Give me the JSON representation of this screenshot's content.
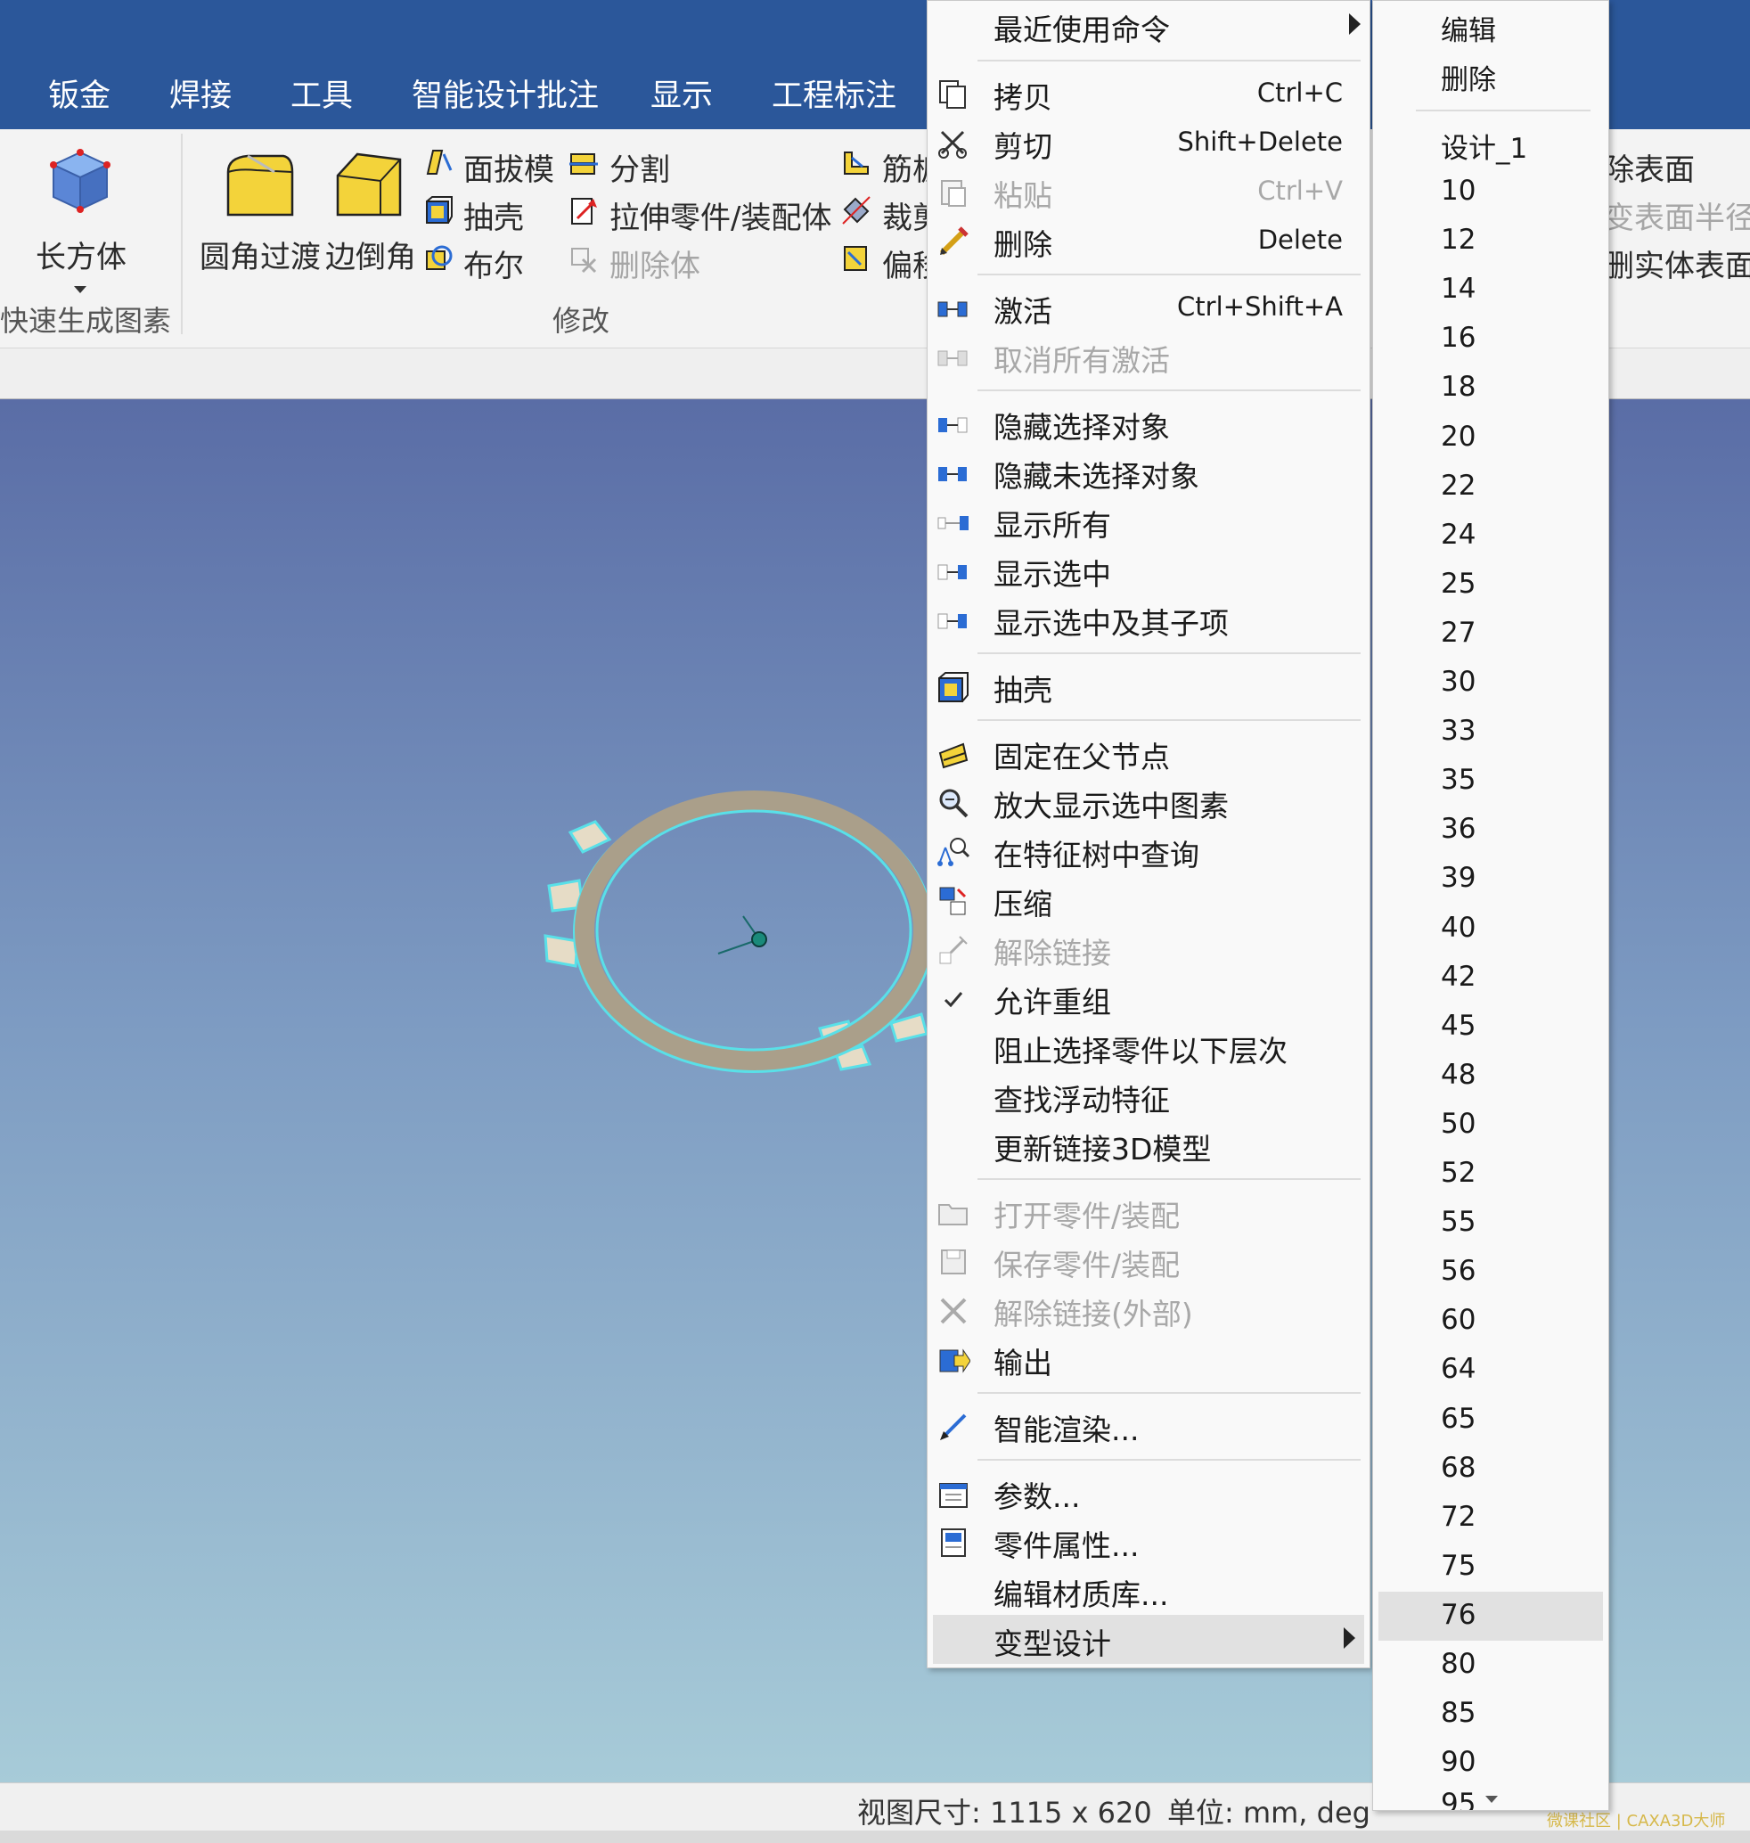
{
  "tabs": [
    "钣金",
    "焊接",
    "工具",
    "智能设计批注",
    "显示",
    "工程标注"
  ],
  "ribbon": {
    "box_label": "长方体",
    "group_quick": "快速生成图素",
    "fillet": "圆角过渡",
    "chamfer": "边倒角",
    "face_draft": "面拔模",
    "shell": "抽壳",
    "boolean": "布尔",
    "split": "分割",
    "stretch": "拉伸零件/装配体",
    "delete_body": "删除体",
    "rib": "筋板",
    "trim": "裁剪",
    "offset": "偏移",
    "group_modify": "修改",
    "right_1": "除表面",
    "right_2": "变表面半径",
    "right_3": "删实体表面"
  },
  "context_menu": {
    "recent": "最近使用命令",
    "copy": {
      "label": "拷贝",
      "shortcut": "Ctrl+C"
    },
    "cut": {
      "label": "剪切",
      "shortcut": "Shift+Delete"
    },
    "paste": {
      "label": "粘贴",
      "shortcut": "Ctrl+V"
    },
    "delete": {
      "label": "删除",
      "shortcut": "Delete"
    },
    "activate": {
      "label": "激活",
      "shortcut": "Ctrl+Shift+A"
    },
    "deactivate_all": "取消所有激活",
    "hide_selected": "隐藏选择对象",
    "hide_unselected": "隐藏未选择对象",
    "show_all": "显示所有",
    "show_selected": "显示选中",
    "show_selected_children": "显示选中及其子项",
    "shell": "抽壳",
    "fix_to_parent": "固定在父节点",
    "zoom_selected": "放大显示选中图素",
    "find_in_tree": "在特征树中查询",
    "compress": "压缩",
    "unlink": "解除链接",
    "allow_regroup": "允许重组",
    "block_select": "阻止选择零件以下层次",
    "find_floating": "查找浮动特征",
    "update_link": "更新链接3D模型",
    "open_part": "打开零件/装配",
    "save_part": "保存零件/装配",
    "unlink_external": "解除链接(外部)",
    "export": "输出",
    "smart_render": "智能渲染...",
    "params": "参数...",
    "part_props": "零件属性...",
    "edit_material": "编辑材质库...",
    "variant_design": "变型设计"
  },
  "submenu": {
    "edit": "编辑",
    "delete": "删除",
    "design": "设计_1",
    "values": [
      "10",
      "12",
      "14",
      "16",
      "18",
      "20",
      "22",
      "24",
      "25",
      "27",
      "30",
      "33",
      "35",
      "36",
      "39",
      "40",
      "42",
      "45",
      "48",
      "50",
      "52",
      "55",
      "56",
      "60",
      "64",
      "65",
      "68",
      "72",
      "75",
      "76",
      "80",
      "85",
      "90"
    ],
    "highlighted": "76",
    "partial": "95"
  },
  "status": {
    "view_size": "视图尺寸: 1115 x  620",
    "units": "单位: mm, deg"
  },
  "watermark": "微课社区 | CAXA3D大师"
}
